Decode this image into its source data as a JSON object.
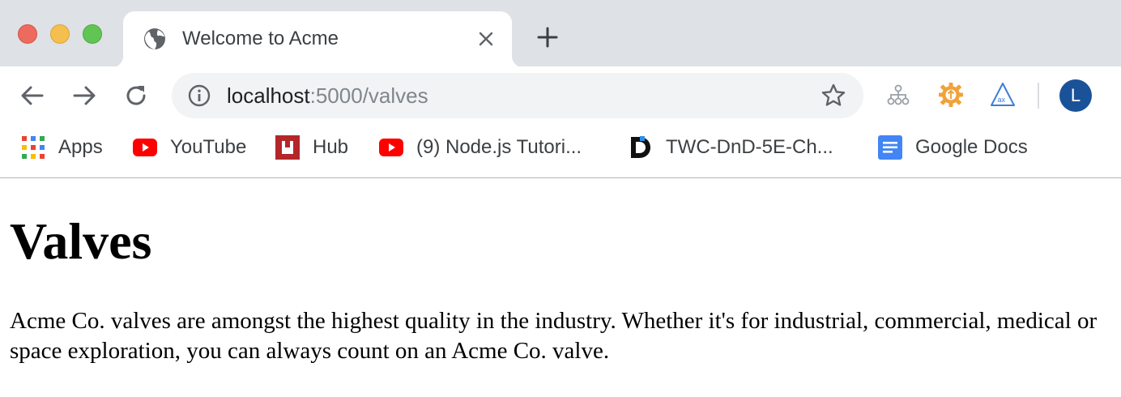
{
  "browser": {
    "tab": {
      "title": "Welcome to Acme",
      "favicon": "globe-icon"
    },
    "address_bar": {
      "host": "localhost",
      "rest": ":5000/valves"
    },
    "profile": {
      "initial": "L",
      "color": "#1a5299"
    },
    "bookmarks": [
      {
        "label": "Apps",
        "icon": "apps-grid-icon"
      },
      {
        "label": "YouTube",
        "icon": "youtube-icon"
      },
      {
        "label": "Hub",
        "icon": "hub-icon"
      },
      {
        "label": "(9) Node.js Tutori...",
        "icon": "youtube-icon"
      },
      {
        "label": "TWC-DnD-5E-Ch...",
        "icon": "d-logo-icon"
      },
      {
        "label": "Google Docs",
        "icon": "google-docs-icon"
      }
    ]
  },
  "page": {
    "heading": "Valves",
    "paragraph": "Acme Co. valves are amongst the highest quality in the industry. Whether it's for industrial, commercial, medical or space exploration, you can always count on an Acme Co. valve."
  }
}
